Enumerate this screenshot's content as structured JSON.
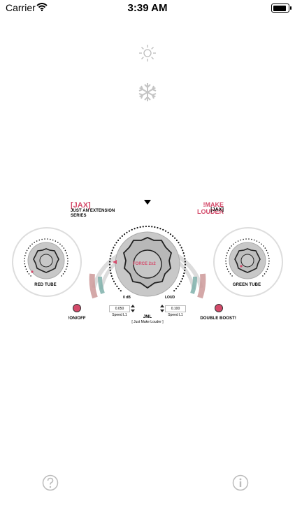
{
  "status_bar": {
    "carrier": "Carrier",
    "time": "3:39 AM"
  },
  "top_icons": [
    {
      "name": "brightness-icon"
    },
    {
      "name": "snowflake-icon"
    }
  ],
  "header": {
    "left_brand": "[JAX]",
    "left_sub1": "JUST AN EXTENSION",
    "left_sub2": "SERIES",
    "right_title": "!MAKE LOUDER",
    "right_sub": "[JAX]"
  },
  "left_knob": {
    "label": "RED TUBE"
  },
  "right_knob": {
    "label": "GREEN TUBE"
  },
  "main_knob": {
    "label": "FORCE 2x2",
    "left_scale": "0 dB",
    "right_scale": "LOUD"
  },
  "controls": {
    "left_field_value": "0.050",
    "right_field_value": "0.100",
    "left_speed_label": "Speed L1",
    "right_speed_label": "Speed L1",
    "center_title": "JML",
    "center_sub": "[ Just Make Louder ]"
  },
  "switches": {
    "left_label": "!ON/OFF",
    "right_label": "DOUBLE BOOST!"
  },
  "bottom_icons": [
    {
      "name": "help-icon"
    },
    {
      "name": "info-icon"
    }
  ],
  "colors": {
    "accent": "#d44a6a",
    "teal": "#7fb0aa",
    "panel_gray": "#dcdcdc"
  }
}
